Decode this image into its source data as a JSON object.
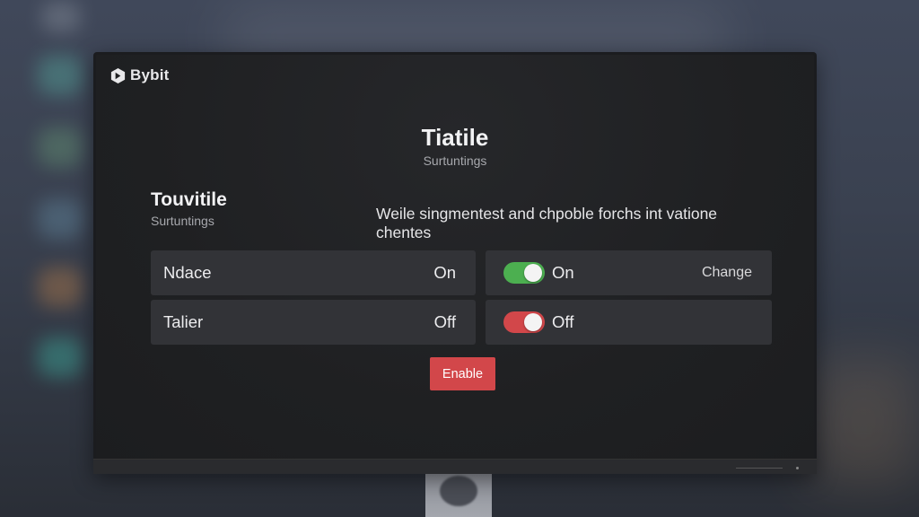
{
  "app": {
    "brand": "Bybit"
  },
  "header": {
    "title": "Tiatile",
    "subtitle": "Surtuntings"
  },
  "section": {
    "title": "Touvitile",
    "subtitle": "Surtuntings",
    "description": "Weile singmentest and chpoble forchs int vatione chentes"
  },
  "settings_rows": [
    {
      "label": "Ndace",
      "value": "On"
    },
    {
      "label": "Talier",
      "value": "Off"
    }
  ],
  "toggle_rows": [
    {
      "state_label": "On",
      "state": "on",
      "color": "#4caf50",
      "action": "Change"
    },
    {
      "state_label": "Off",
      "state": "off",
      "color": "#d2474a"
    }
  ],
  "buttons": {
    "enable": "Enable"
  },
  "colors": {
    "accent_green": "#4caf50",
    "accent_red": "#d2474a"
  }
}
